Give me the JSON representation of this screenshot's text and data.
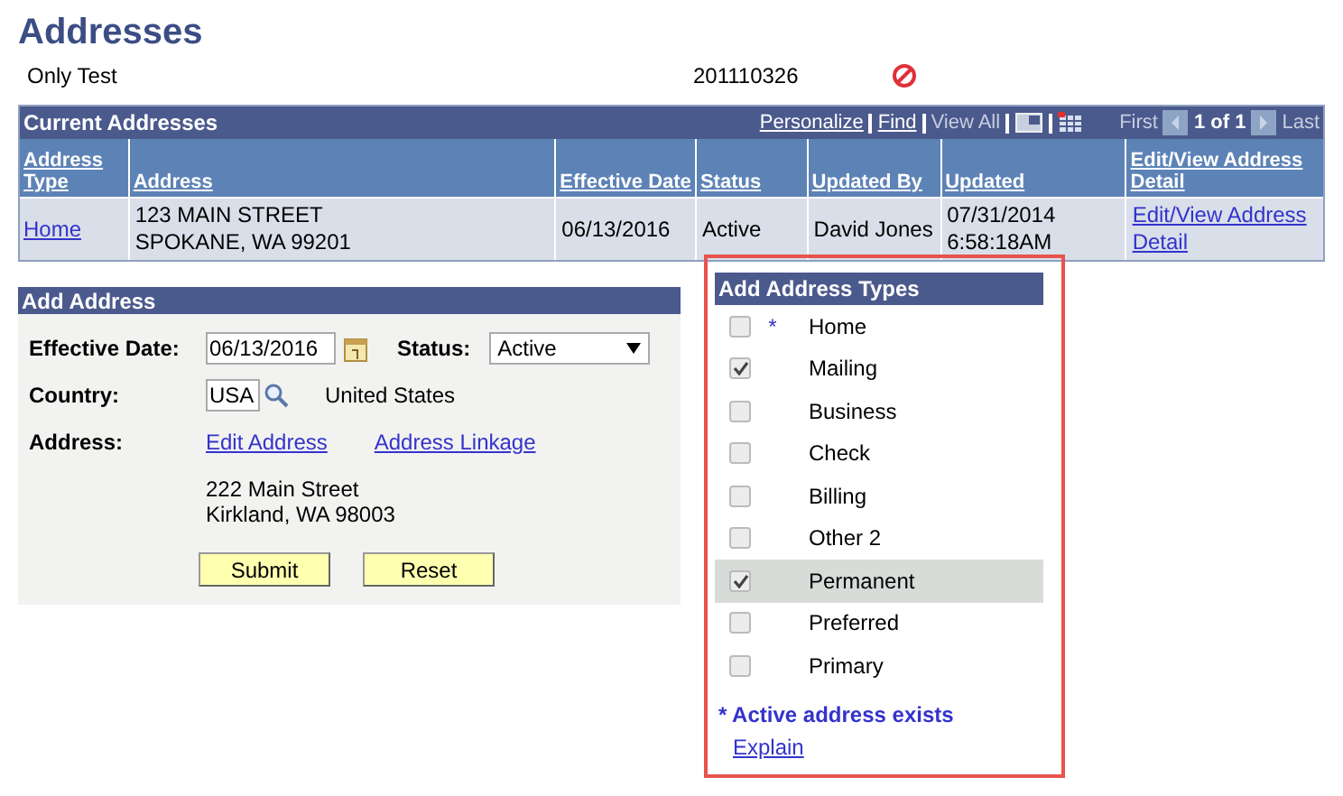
{
  "page_title": "Addresses",
  "person": {
    "name": "Only Test",
    "id": "201110326"
  },
  "current_addresses": {
    "title": "Current Addresses",
    "toolbar": {
      "personalize": "Personalize",
      "find": "Find",
      "view_all": "View All",
      "first": "First",
      "page": "1 of 1",
      "last": "Last"
    },
    "columns": [
      "Address Type",
      "Address",
      "Effective Date",
      "Status",
      "Updated By",
      "Updated",
      "Edit/View Address Detail"
    ],
    "rows": [
      {
        "type": "Home",
        "address": [
          "123 MAIN STREET",
          "SPOKANE, WA 99201"
        ],
        "effective_date": "06/13/2016",
        "status": "Active",
        "updated_by": "David Jones",
        "updated": [
          "07/31/2014",
          "6:58:18AM"
        ],
        "edit": "Edit/View Address Detail"
      }
    ]
  },
  "add_address": {
    "title": "Add Address",
    "effective_date_label": "Effective Date:",
    "effective_date": "06/13/2016",
    "status_label": "Status:",
    "status": "Active",
    "country_label": "Country:",
    "country_code": "USA",
    "country_name": "United States",
    "address_label": "Address:",
    "edit_link": "Edit Address",
    "linkage_link": "Address Linkage",
    "address_lines": [
      "222 Main Street",
      "Kirkland, WA 98003"
    ],
    "buttons": [
      "Submit",
      "Reset"
    ]
  },
  "address_types": {
    "title": "Add Address Types",
    "items": [
      {
        "label": "Home",
        "checked": false,
        "selected": false,
        "active_mark": "*"
      },
      {
        "label": "Mailing",
        "checked": true,
        "selected": false
      },
      {
        "label": "Business",
        "checked": false,
        "selected": false
      },
      {
        "label": "Check",
        "checked": false,
        "selected": false
      },
      {
        "label": "Billing",
        "checked": false,
        "selected": false
      },
      {
        "label": "Other 2",
        "checked": false,
        "selected": false
      },
      {
        "label": "Permanent",
        "checked": true,
        "selected": true
      },
      {
        "label": "Preferred",
        "checked": false,
        "selected": false
      },
      {
        "label": "Primary",
        "checked": false,
        "selected": false
      }
    ],
    "note": "* Active address exists",
    "explain": "Explain"
  }
}
